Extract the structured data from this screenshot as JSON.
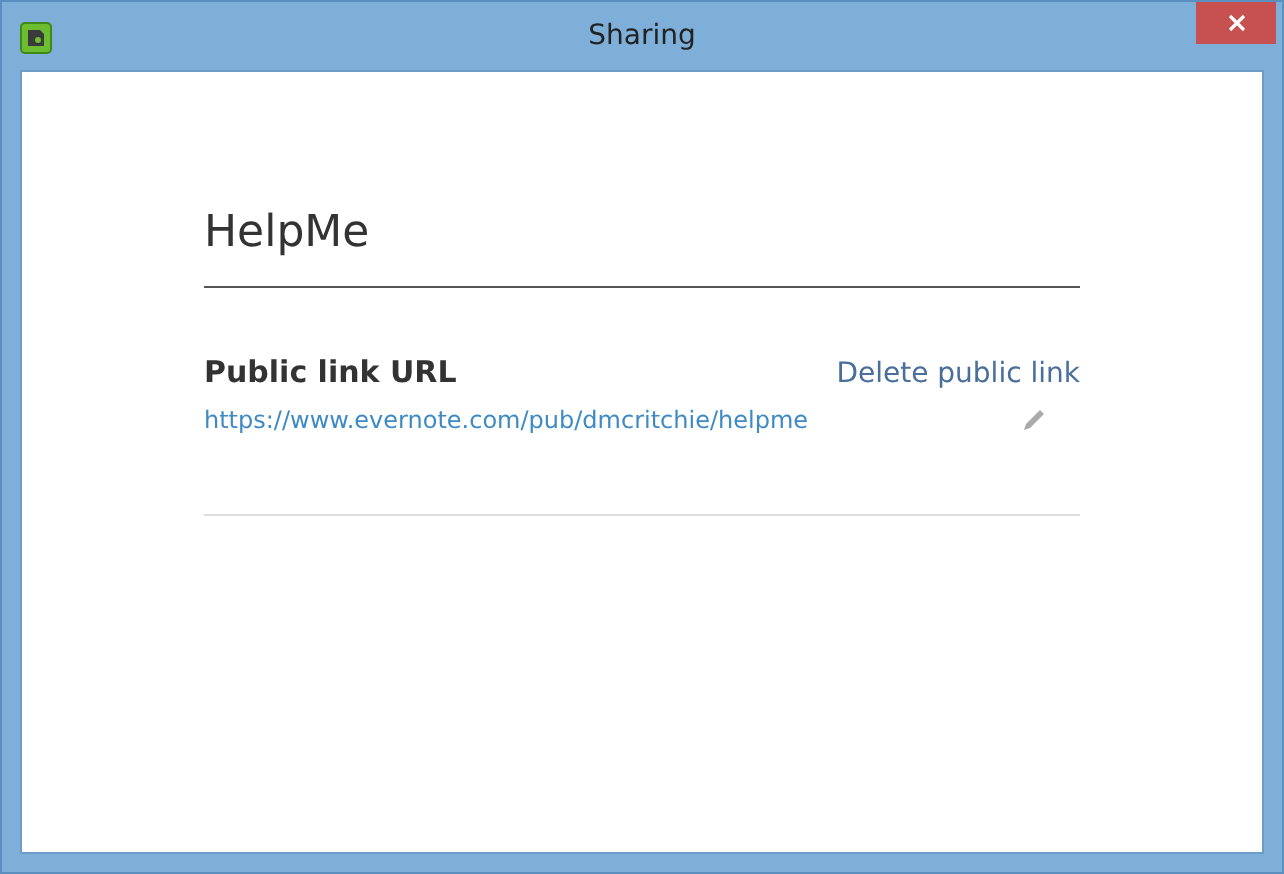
{
  "window": {
    "title": "Sharing"
  },
  "note": {
    "title": "HelpMe"
  },
  "public_link": {
    "label": "Public link URL",
    "delete_link": "Delete public link",
    "url": "https://www.evernote.com/pub/dmcritchie/helpme"
  }
}
